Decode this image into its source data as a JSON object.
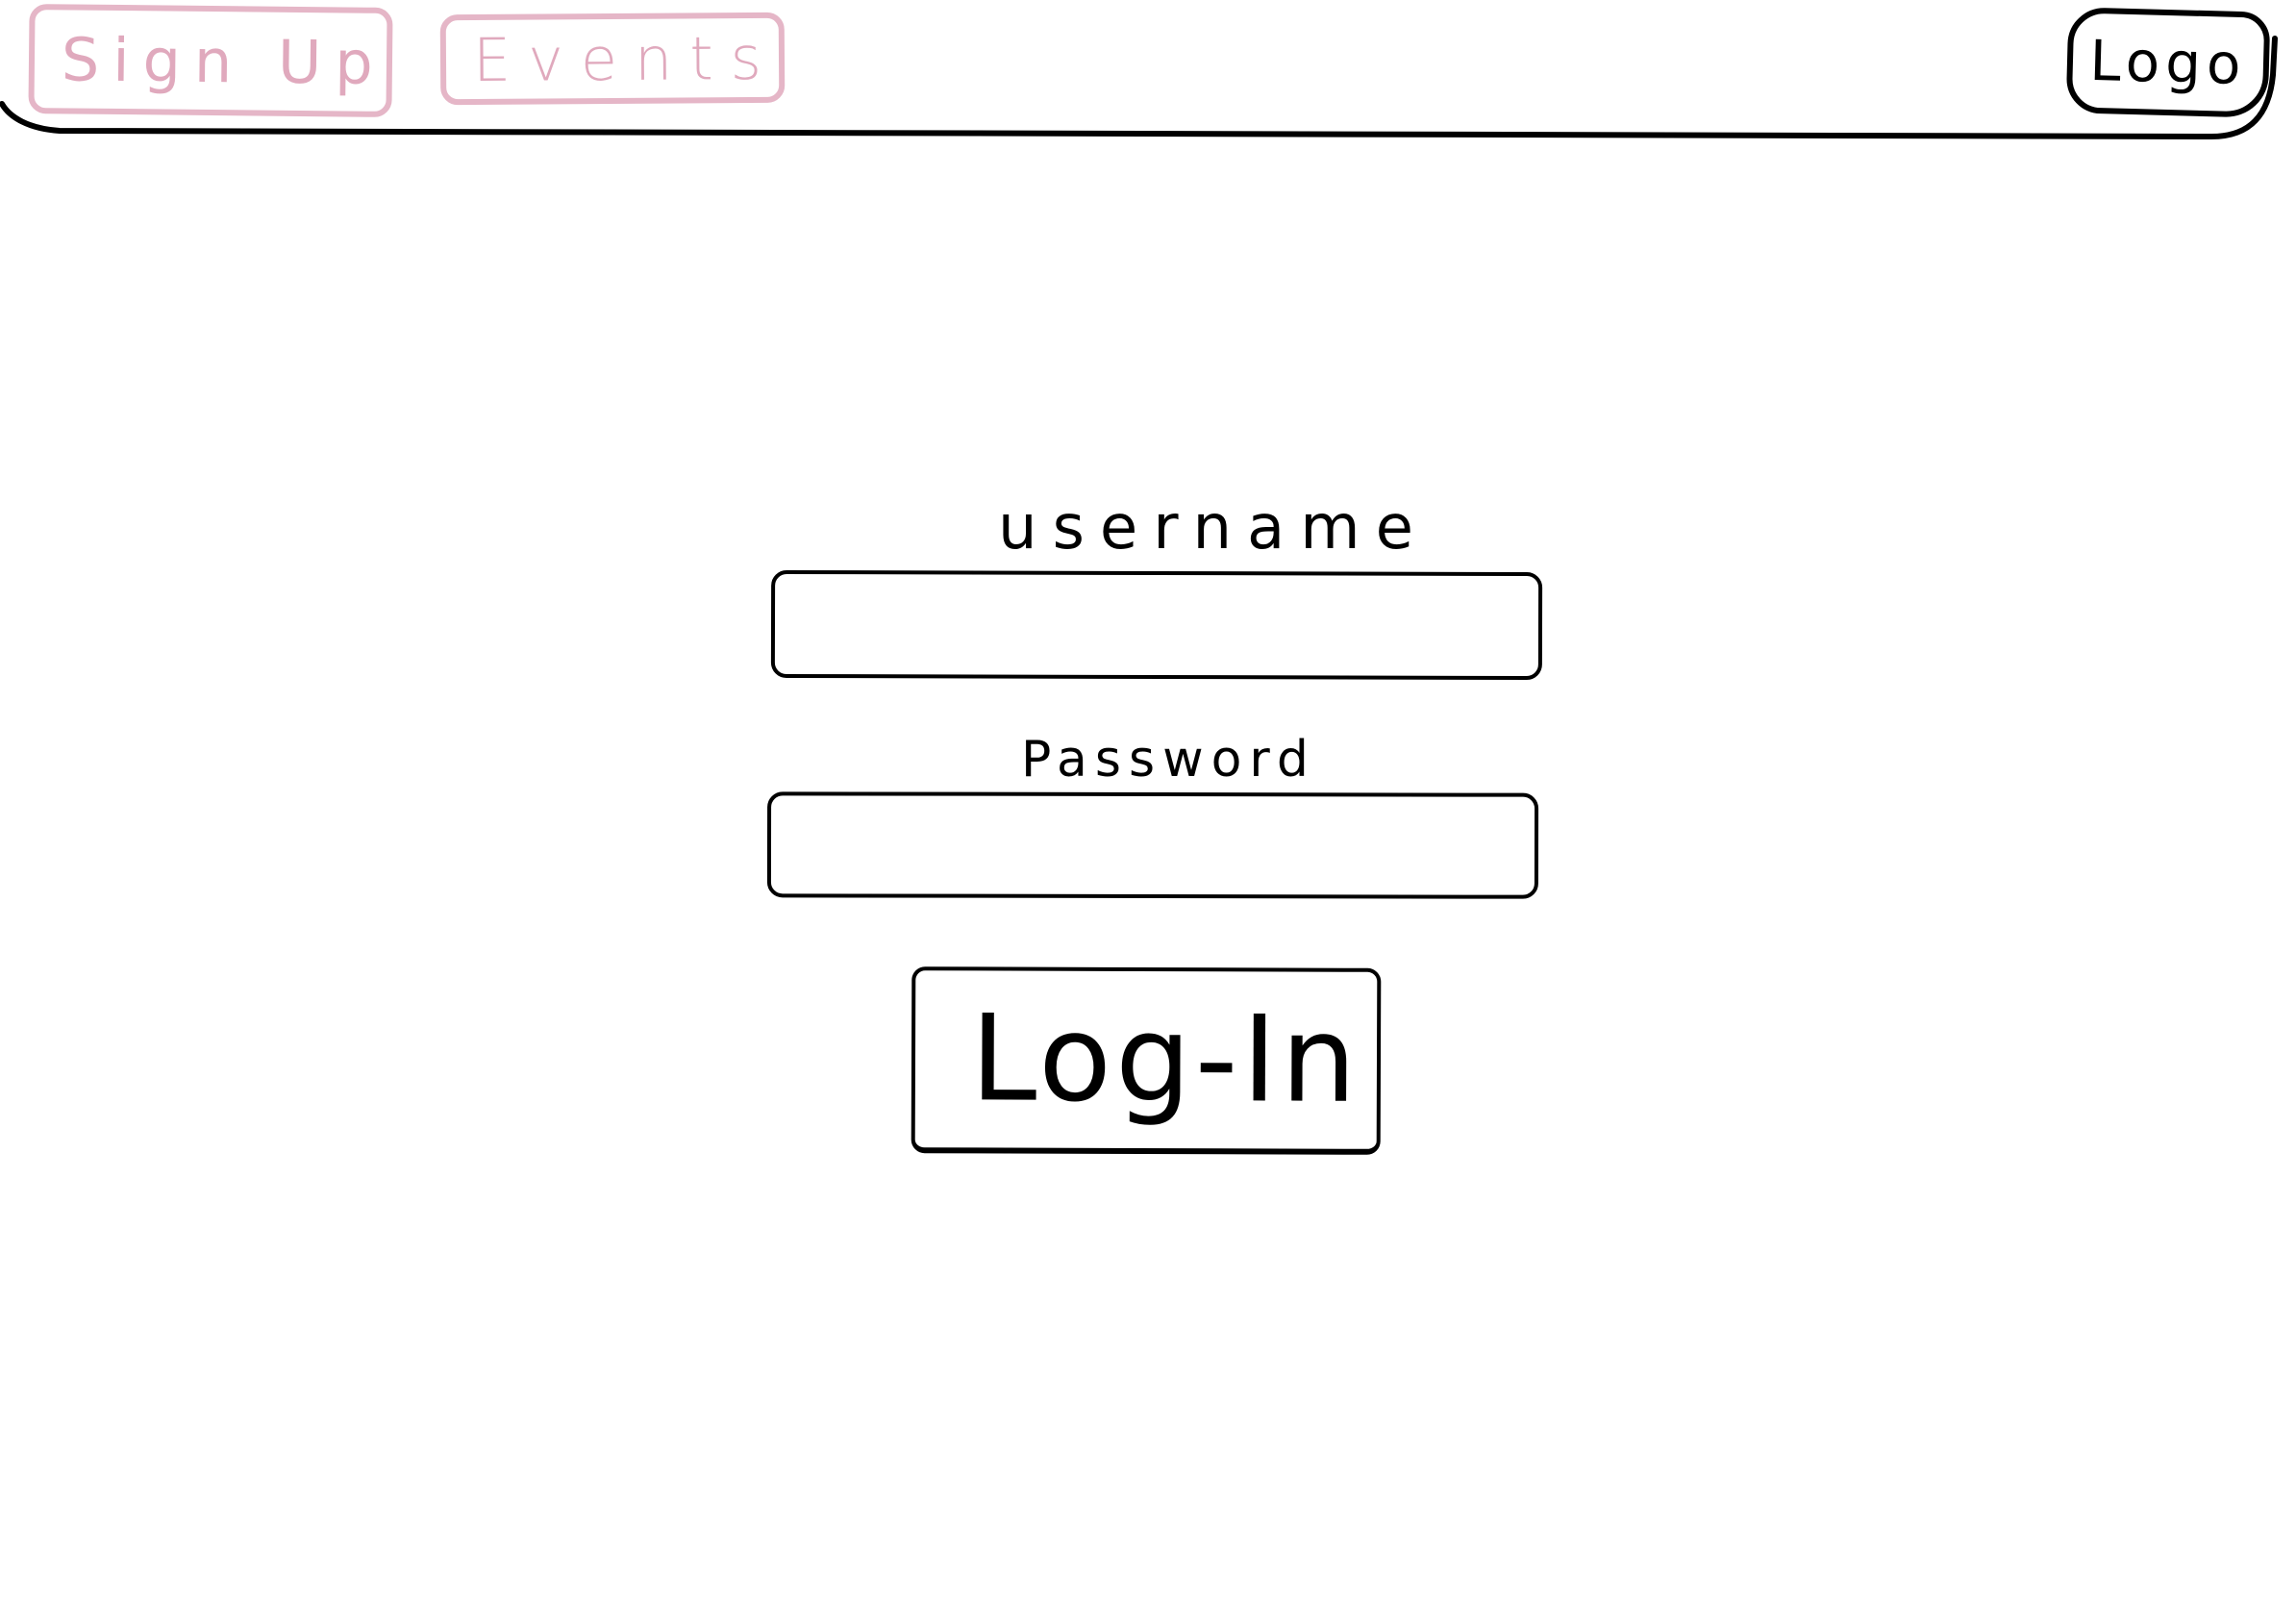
{
  "nav": {
    "signup_label": "Sign Up",
    "events_label": "Events",
    "logo_text": "Logo"
  },
  "form": {
    "username_label": "username",
    "username_value": "",
    "password_label": "Password",
    "password_value": "",
    "login_label": "Log-In"
  },
  "colors": {
    "nav_accent": "#e5b6c7",
    "ink": "#000000",
    "background": "#ffffff"
  }
}
